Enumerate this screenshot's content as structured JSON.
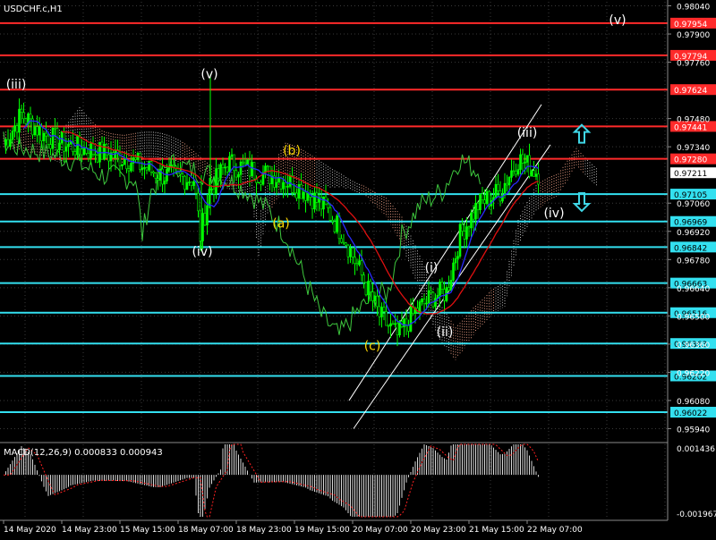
{
  "chart_data": [
    {
      "type": "candlestick",
      "title": "USDCHF.c,H1",
      "x_ticks": [
        "14 May 2020",
        "14 May 23:00",
        "15 May 15:00",
        "18 May 07:00",
        "18 May 23:00",
        "19 May 15:00",
        "20 May 07:00",
        "20 May 23:00",
        "21 May 15:00",
        "22 May 07:00"
      ],
      "price_axis_labels": [
        "0.98040",
        "0.97900",
        "0.97760",
        "0.97480",
        "0.97340",
        "0.97060",
        "0.96920",
        "0.96780",
        "0.96640",
        "0.96500",
        "0.96360",
        "0.96220",
        "0.96080",
        "0.95940"
      ],
      "ylim": [
        0.9588,
        0.9806
      ],
      "current_price": "0.97211",
      "resistance_levels": [
        {
          "value": 0.97954,
          "label": "0.97954"
        },
        {
          "value": 0.97794,
          "label": "0.97794"
        },
        {
          "value": 0.97624,
          "label": "0.97624"
        },
        {
          "value": 0.97441,
          "label": "0.97441"
        },
        {
          "value": 0.9728,
          "label": "0.97280"
        }
      ],
      "support_levels": [
        {
          "value": 0.97105,
          "label": "0.97105"
        },
        {
          "value": 0.96969,
          "label": "0.96969"
        },
        {
          "value": 0.96842,
          "label": "0.96842"
        },
        {
          "value": 0.96663,
          "label": "0.96663"
        },
        {
          "value": 0.96516,
          "label": "0.96516"
        },
        {
          "value": 0.96363,
          "label": "0.96363"
        },
        {
          "value": 0.96202,
          "label": "0.96202"
        },
        {
          "value": 0.96022,
          "label": "0.96022"
        }
      ],
      "wave_labels": [
        {
          "text": "(iii)",
          "price": 0.9763,
          "color": "#ffffff"
        },
        {
          "text": "(v)",
          "price": 0.9768,
          "color": "#ffffff"
        },
        {
          "text": "(iv)",
          "price": 0.968,
          "color": "#ffffff"
        },
        {
          "text": "(b)",
          "price": 0.973,
          "color": "#ffd800"
        },
        {
          "text": "(a)",
          "price": 0.9694,
          "color": "#ffd800"
        },
        {
          "text": "(c)",
          "price": 0.9633,
          "color": "#ffd800"
        },
        {
          "text": "(i)",
          "price": 0.9672,
          "color": "#ffffff"
        },
        {
          "text": "(ii)",
          "price": 0.964,
          "color": "#ffffff"
        },
        {
          "text": "(iii)",
          "price": 0.9739,
          "color": "#ffffff"
        },
        {
          "text": "(iv)",
          "price": 0.9699,
          "color": "#ffffff"
        },
        {
          "text": "(v)",
          "price": 0.9795,
          "color": "#ffffff"
        }
      ],
      "arrows": [
        {
          "direction": "up",
          "price": 0.974,
          "color": "#3fd6e6"
        },
        {
          "direction": "down",
          "price": 0.9707,
          "color": "#3fd6e6"
        }
      ],
      "colors": {
        "background": "#000000",
        "bullish_candle": "#00ff00",
        "resistance": "#ff2a2a",
        "support": "#33e0f0",
        "ma_red": "#e01010",
        "ma_blue": "#2a2aff",
        "chikou_green": "#3ec83e",
        "cloud_salmon": "#f2a488",
        "cloud_white": "#cccccc",
        "price_tag_red": "#ff2020",
        "text": "#ffffff"
      }
    },
    {
      "type": "macd",
      "label": "MACD(12,26,9) 0.000833 0.000943",
      "y_axis_labels": [
        "0.001436",
        "-0.001967"
      ],
      "ylim": [
        -0.001967,
        0.001436
      ]
    }
  ]
}
